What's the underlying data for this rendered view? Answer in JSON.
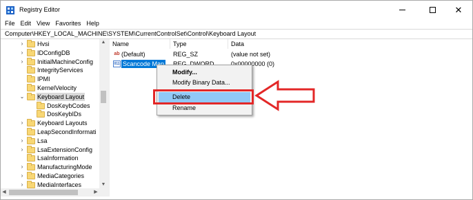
{
  "window": {
    "title": "Registry Editor"
  },
  "menu": [
    "File",
    "Edit",
    "View",
    "Favorites",
    "Help"
  ],
  "address": "Computer\\HKEY_LOCAL_MACHINE\\SYSTEM\\CurrentControlSet\\Control\\Keyboard Layout",
  "tree": {
    "items": [
      {
        "label": "Hvsi",
        "indent": 0,
        "expandable": true,
        "expanded": false,
        "selected": false
      },
      {
        "label": "IDConfigDB",
        "indent": 0,
        "expandable": true,
        "expanded": false,
        "selected": false
      },
      {
        "label": "InitialMachineConfig",
        "indent": 0,
        "expandable": true,
        "expanded": false,
        "selected": false
      },
      {
        "label": "IntegrityServices",
        "indent": 0,
        "expandable": false,
        "expanded": false,
        "selected": false
      },
      {
        "label": "IPMI",
        "indent": 0,
        "expandable": false,
        "expanded": false,
        "selected": false
      },
      {
        "label": "KernelVelocity",
        "indent": 0,
        "expandable": false,
        "expanded": false,
        "selected": false
      },
      {
        "label": "Keyboard Layout",
        "indent": 0,
        "expandable": true,
        "expanded": true,
        "selected": true
      },
      {
        "label": "DosKeybCodes",
        "indent": 1,
        "expandable": false,
        "expanded": false,
        "selected": false
      },
      {
        "label": "DosKeybIDs",
        "indent": 1,
        "expandable": false,
        "expanded": false,
        "selected": false
      },
      {
        "label": "Keyboard Layouts",
        "indent": 0,
        "expandable": true,
        "expanded": false,
        "selected": false
      },
      {
        "label": "LeapSecondInformati",
        "indent": 0,
        "expandable": false,
        "expanded": false,
        "selected": false
      },
      {
        "label": "Lsa",
        "indent": 0,
        "expandable": true,
        "expanded": false,
        "selected": false
      },
      {
        "label": "LsaExtensionConfig",
        "indent": 0,
        "expandable": true,
        "expanded": false,
        "selected": false
      },
      {
        "label": "LsaInformation",
        "indent": 0,
        "expandable": false,
        "expanded": false,
        "selected": false
      },
      {
        "label": "ManufacturingMode",
        "indent": 0,
        "expandable": true,
        "expanded": false,
        "selected": false
      },
      {
        "label": "MediaCategories",
        "indent": 0,
        "expandable": true,
        "expanded": false,
        "selected": false
      },
      {
        "label": "MediaInterfaces",
        "indent": 0,
        "expandable": true,
        "expanded": false,
        "selected": false
      }
    ]
  },
  "list": {
    "columns": [
      "Name",
      "Type",
      "Data"
    ],
    "rows": [
      {
        "icon": "string-value-icon",
        "glyph": "ab",
        "name": "(Default)",
        "type": "REG_SZ",
        "data": "(value not set)",
        "selected": false
      },
      {
        "icon": "binary-value-icon",
        "glyph": "011",
        "name": "Scancode Map",
        "type": "REG_DWORD",
        "data": "0x00000000 (0)",
        "selected": true
      }
    ]
  },
  "context_menu": {
    "items": [
      {
        "label": "Modify...",
        "bold": true
      },
      {
        "label": "Modify Binary Data...",
        "bold": false
      },
      {
        "label": "Delete",
        "bold": false,
        "highlighted": true
      },
      {
        "label": "Rename",
        "bold": false
      }
    ]
  },
  "colors": {
    "selection": "#0078d7",
    "menu_hover": "#91c9f7",
    "annotation": "#e32727",
    "folder": "#f8d775"
  },
  "icons": {
    "app": "registry-editor-icon",
    "folder": "folder-icon",
    "expand": "chevron-right-icon",
    "collapse": "chevron-down-icon",
    "minimize": "minimize-icon",
    "maximize": "maximize-icon",
    "close": "close-icon",
    "annotation_arrow": "left-arrow-icon"
  }
}
